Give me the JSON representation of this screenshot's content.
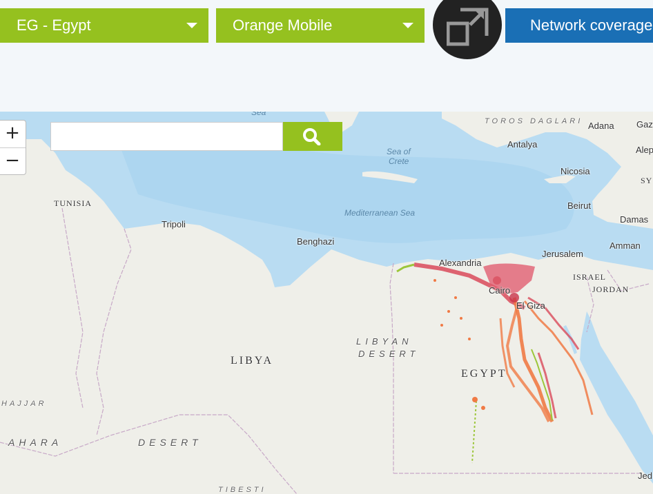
{
  "toolbar": {
    "country_select": "EG - Egypt",
    "operator_select": "Orange Mobile",
    "fullscreen_icon": "expand-icon",
    "coverage_button": "Network coverage"
  },
  "map": {
    "zoom_in": "+",
    "zoom_out": "−",
    "search": {
      "value": "",
      "placeholder": ""
    },
    "search_icon": "search-icon",
    "labels": {
      "sea_top": "Sea",
      "tunisia": "TUNISIA",
      "tripoli": "Tripoli",
      "benghazi": "Benghazi",
      "mediterranean": "Mediterranean Sea",
      "sea_of_crete_1": "Sea of",
      "sea_of_crete_2": "Crete",
      "toros": "TOROS DAGLARI",
      "antalya": "Antalya",
      "adana": "Adana",
      "gaz": "Gaz",
      "aleppo": "Alep",
      "sy": "SY",
      "nicosia": "Nicosia",
      "beirut": "Beirut",
      "damascus": "Damas",
      "amman": "Amman",
      "jerusalem": "Jerusalem",
      "israel": "ISRAEL",
      "jordan": "JORDAN",
      "alexandria": "Alexandria",
      "cairo": "Cairo",
      "elgiza": "El Giza",
      "libyan_desert_1": "LIBYAN",
      "libyan_desert_2": "DESERT",
      "libya": "LIBYA",
      "egypt": "EGYPT",
      "hajjar": "HAJJAR",
      "sahara": "AHARA",
      "desert": "DESERT",
      "tibesti": "TIBESTI",
      "jed": "Jed"
    },
    "colors": {
      "water": "#b9dcf2",
      "land": "#efefe9",
      "coverage_high": "#d94a5a",
      "coverage_mid": "#f07a45",
      "coverage_low": "#9cc63a"
    }
  }
}
